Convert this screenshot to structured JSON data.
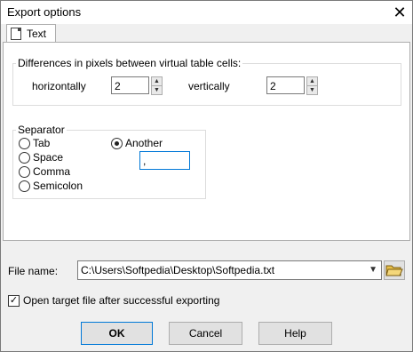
{
  "window": {
    "title": "Export options",
    "close_glyph": "✕"
  },
  "tab": {
    "label": "Text",
    "icon": "document-icon"
  },
  "pixels_group": {
    "title": "Differences in pixels between virtual table cells:",
    "horizontal_label": "horizontally",
    "horizontal_value": "2",
    "vertical_label": "vertically",
    "vertical_value": "2"
  },
  "separator_group": {
    "title": "Separator",
    "options": [
      "Tab",
      "Space",
      "Comma",
      "Semicolon",
      "Another"
    ],
    "selected": "Another",
    "another_value": ","
  },
  "file": {
    "label": "File name:",
    "value": "C:\\Users\\Softpedia\\Desktop\\Softpedia.txt",
    "browse_icon": "folder-open-icon"
  },
  "open_after": {
    "label": "Open target file after successful exporting",
    "checked": true
  },
  "buttons": {
    "ok": "OK",
    "cancel": "Cancel",
    "help": "Help"
  }
}
